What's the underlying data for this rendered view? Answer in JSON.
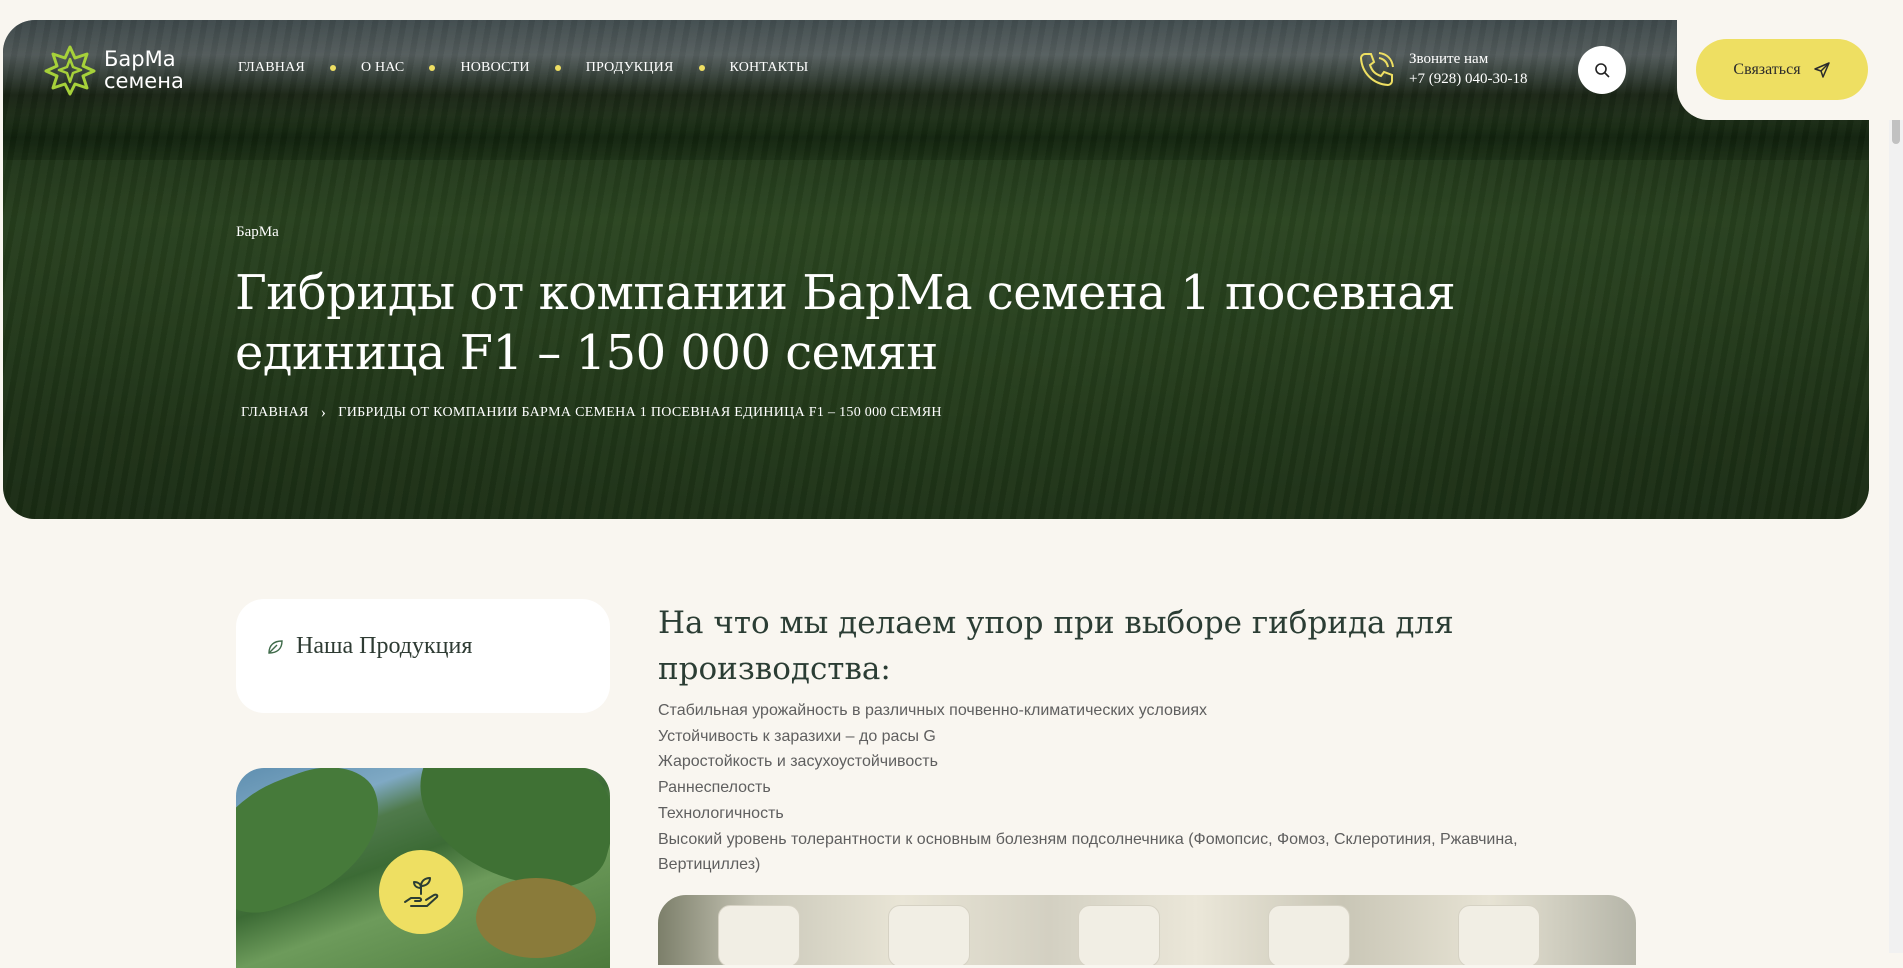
{
  "header": {
    "logo": {
      "line1": "БарМа",
      "line2": "семена"
    },
    "nav": [
      {
        "label": "ГЛАВНАЯ"
      },
      {
        "label": "О НАС"
      },
      {
        "label": "НОВОСТИ"
      },
      {
        "label": "ПРОДУКЦИЯ"
      },
      {
        "label": "КОНТАКТЫ"
      }
    ],
    "phone": {
      "caption": "Звоните нам",
      "number": "+7 (928) 040-30-18"
    },
    "contact_button": "Связаться"
  },
  "hero": {
    "subtitle": "БарМа",
    "title": "Гибриды от компании БарМа семена 1 посевная единица F1 – 150 000 семян",
    "breadcrumbs": {
      "home": "ГЛАВНАЯ",
      "current": "ГИБРИДЫ ОТ КОМПАНИИ БАРМА СЕМЕНА 1 ПОСЕВНАЯ ЕДИНИЦА F1 – 150 000 СЕМЯН"
    }
  },
  "sidebar": {
    "title": "Наша Продукция"
  },
  "content": {
    "title": "На что мы делаем упор при выборе гибрида для производства:",
    "items": [
      "Стабильная урожайность в различных почвенно-климатических условиях",
      "Устойчивость к заразихи – до расы G",
      "Жаростойкость и засухоустойчивость",
      "Раннеспелость",
      "Технологичность",
      "Высокий уровень толерантности к основным болезням подсолнечника (Фомопсис, Фомоз, Склеротиния, Ржавчина, Вертициллез)"
    ]
  },
  "colors": {
    "accent": "#eedf62",
    "logo_green": "#a6d13a",
    "background": "#f9f6f0",
    "heading": "#2b3d34"
  }
}
